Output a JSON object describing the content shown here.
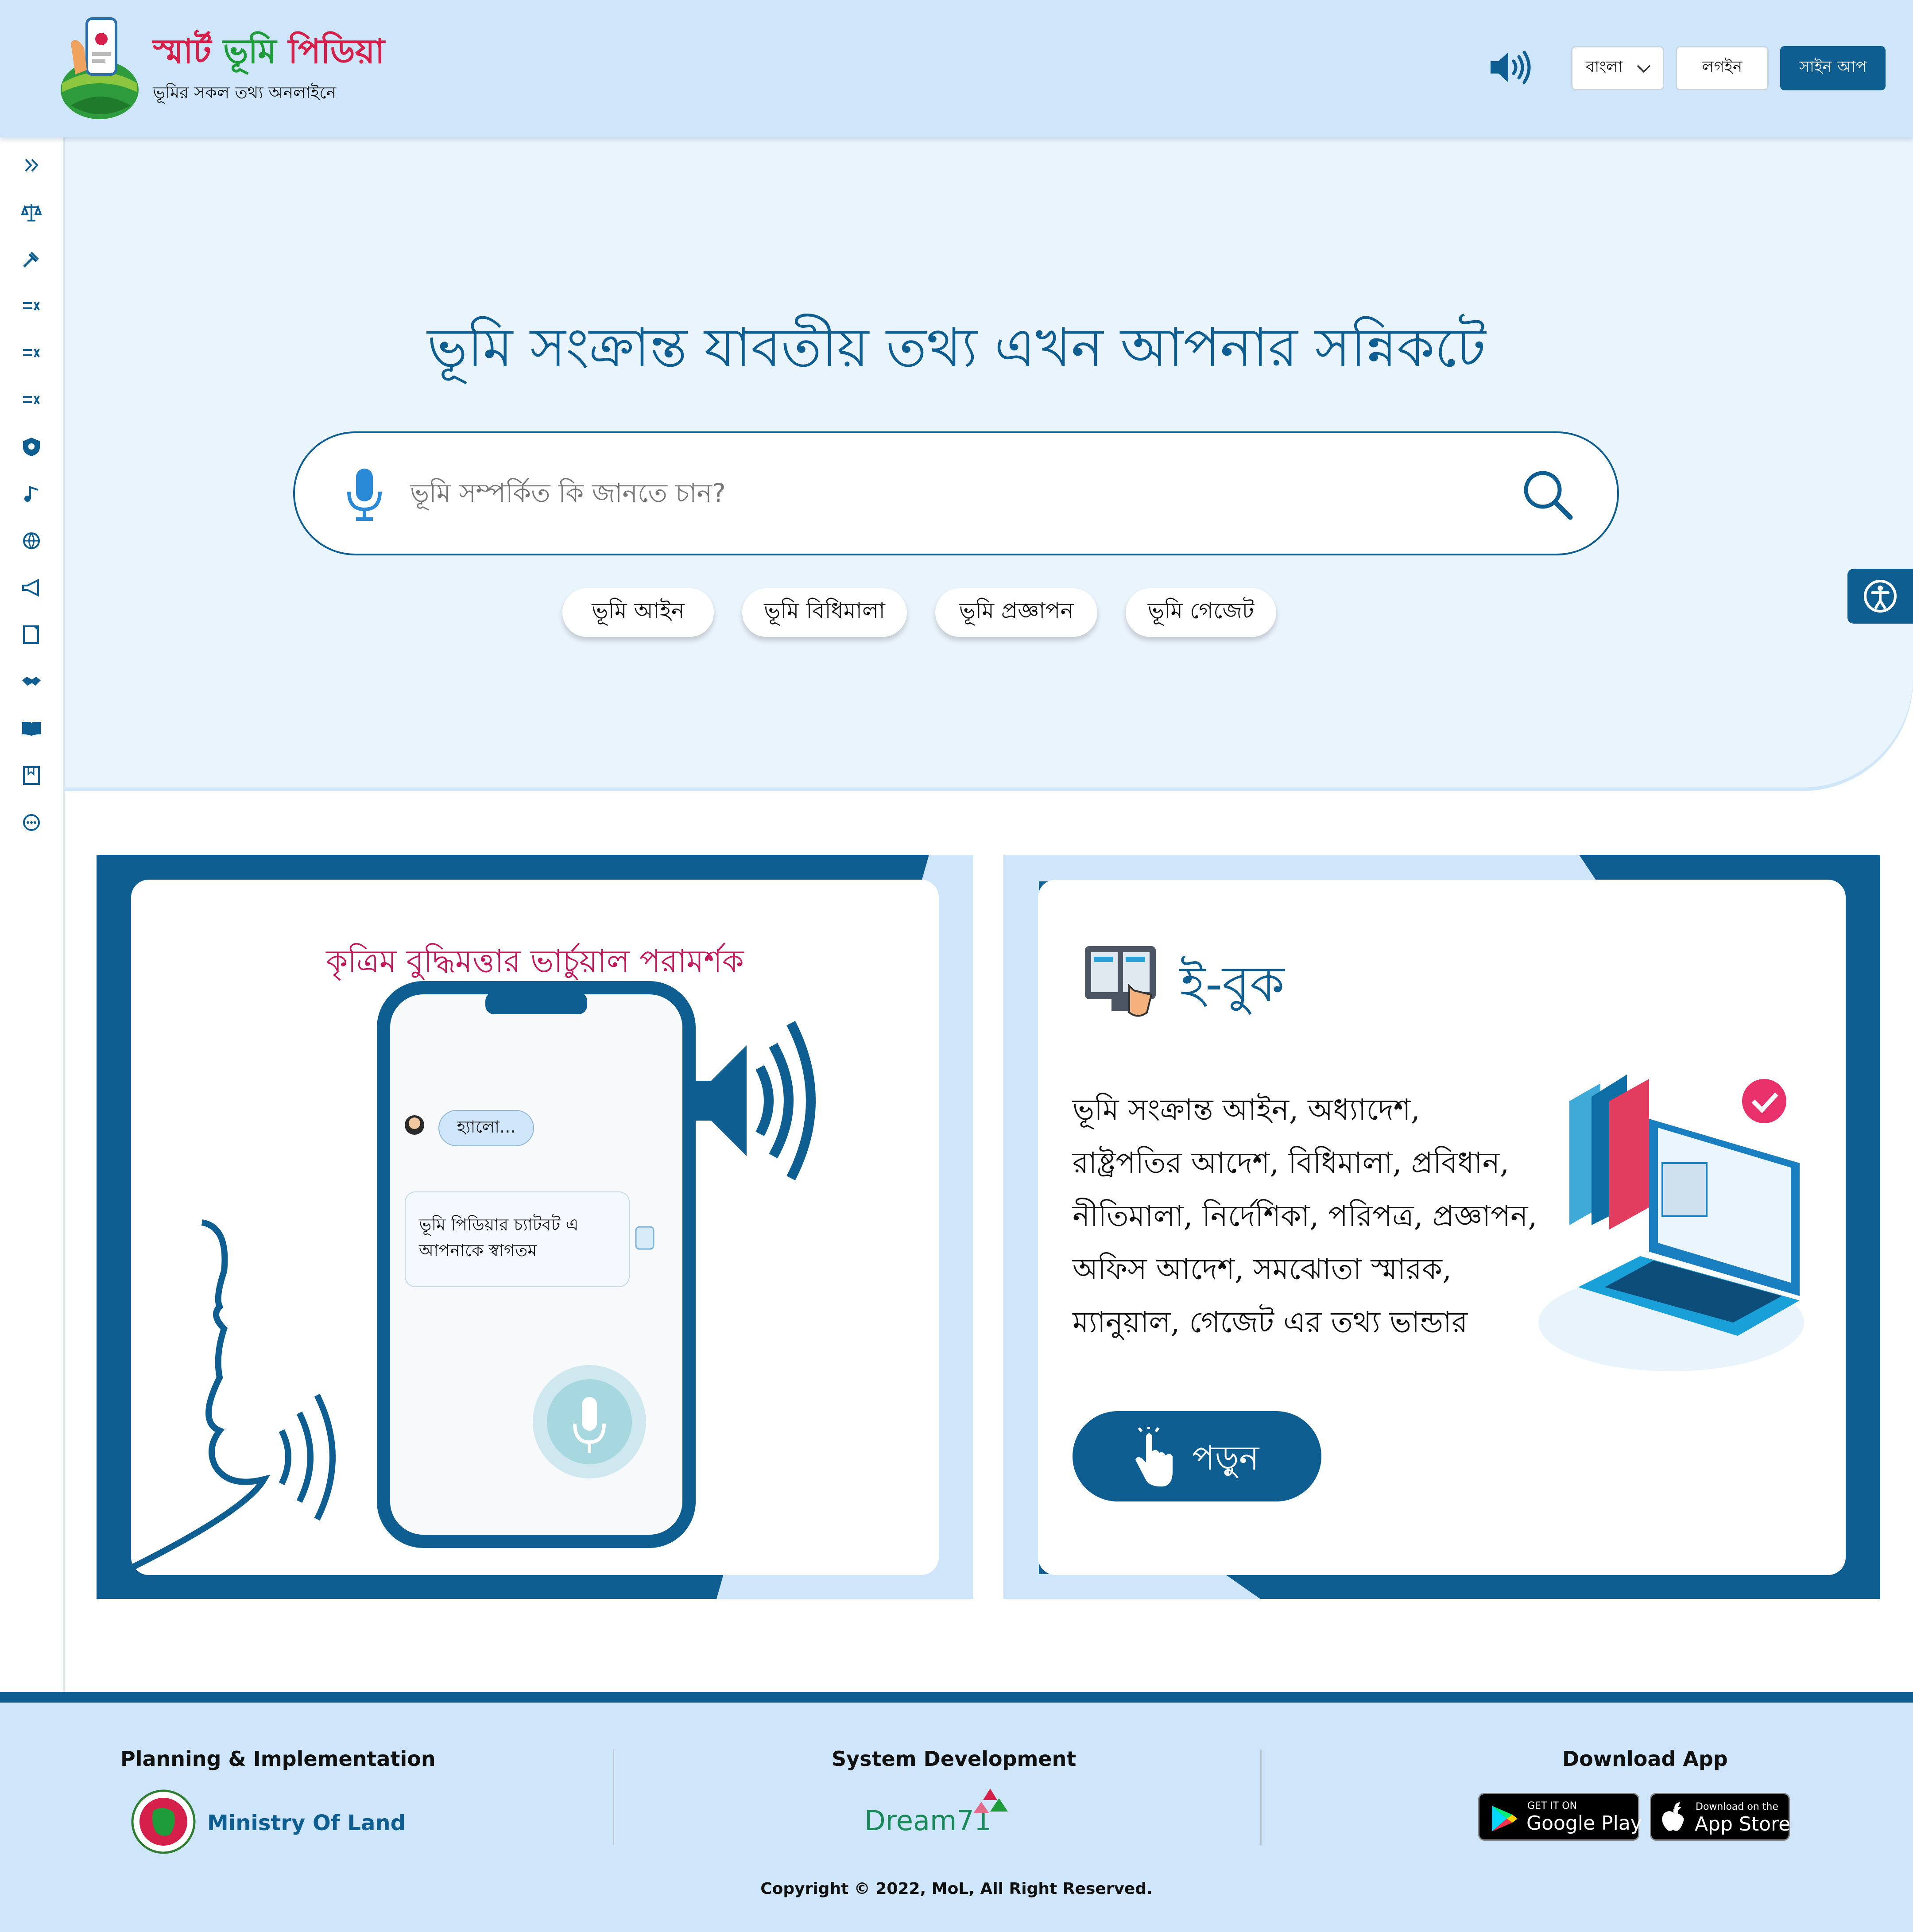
{
  "header": {
    "brand": {
      "part1": "স্মার্ট",
      "part2": "ভূমি",
      "part3": "পিডিয়া"
    },
    "tagline": "ভূমির সকল তথ্য অনলাইনে",
    "language": "বাংলা",
    "login": "লগইন",
    "signup": "সাইন আপ"
  },
  "sidebar": {
    "icons": [
      "expand-icon",
      "scales-icon",
      "gavel-icon",
      "list-icon",
      "list-icon",
      "list-icon",
      "shield-icon",
      "music-icon",
      "globe-icon",
      "megaphone-icon",
      "note-icon",
      "handshake-icon",
      "book-icon",
      "bookmark-icon",
      "more-icon"
    ]
  },
  "hero": {
    "title": "ভূমি সংক্রান্ত যাবতীয় তথ্য এখন আপনার সন্নিকটে",
    "search_placeholder": "ভূমি সম্পর্কিত কি জানতে চান?",
    "chips": [
      "ভূমি আইন",
      "ভূমি বিধিমালা",
      "ভূমি প্রজ্ঞাপন",
      "ভূমি গেজেট"
    ]
  },
  "ai_card": {
    "title": "কৃত্রিম বুদ্ধিমত্তার ভার্চুয়াল পরামর্শক",
    "hello": "হ্যালো...",
    "bot_line1": "ভূমি পিডিয়ার চ্যাটবট এ",
    "bot_line2": "আপনাকে স্বাগতম"
  },
  "ebook_card": {
    "title": "ই-বুক",
    "lines": [
      "ভূমি সংক্রান্ত আইন, অধ্যাদেশ,",
      "রাষ্ট্রপতির আদেশ, বিধিমালা, প্রবিধান,",
      "নীতিমালা, নির্দেশিকা, পরিপত্র, প্রজ্ঞাপন,",
      "অফিস আদেশ, সমঝোতা স্মারক,",
      "ম্যানুয়াল, গেজেট এর তথ্য ভান্ডার"
    ],
    "read": "পড়ুন"
  },
  "footer": {
    "planning_heading": "Planning & Implementation",
    "ministry": "Ministry Of Land",
    "system_heading": "System Development",
    "dream": "Dream71",
    "download_heading": "Download App",
    "google_small": "GET IT ON",
    "google_big": "Google Play",
    "apple_small": "Download on the",
    "apple_big": "App Store",
    "copyright": "Copyright © 2022, MoL, All Right Reserved."
  },
  "colors": {
    "primary": "#0e5e92",
    "light": "#cfe6fa",
    "hero_bg": "#eaf4fd",
    "brand_red": "#d4204a",
    "brand_green": "#1f9c3a",
    "ai_title": "#c2185b"
  }
}
